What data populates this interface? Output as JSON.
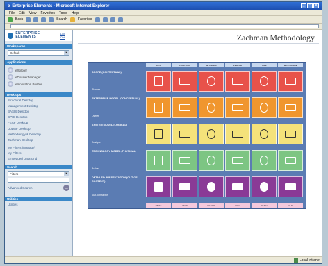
{
  "window": {
    "title": "Enterprise Elements - Microsoft Internet Explorer"
  },
  "menu": [
    "File",
    "Edit",
    "View",
    "Favorites",
    "Tools",
    "Help"
  ],
  "toolbar": {
    "back": "Back",
    "search": "Search",
    "favorites": "Favorites"
  },
  "sidebar": {
    "logo": "ENTERPRISE ELEMENTS",
    "logout": "Log Out",
    "workspaces": {
      "header": "Workspaces",
      "value": "Default"
    },
    "applications": {
      "header": "Applications",
      "items": [
        "eXplorer",
        "eDossier Manager",
        "eInnovation Builder"
      ]
    },
    "desktops": {
      "header": "Desktops",
      "items": [
        "Structural Desktop",
        "Management Desktop",
        "BASIS Desktop",
        "CPIC Desktop",
        "FEAF Desktop",
        "DoDAF Desktop",
        "Methodology & Desktop",
        "Zachman Desktop",
        "My Filters (Manage)",
        "My Filters",
        "Embedded Data Grid"
      ]
    },
    "search": {
      "header": "Search",
      "value": "Filters",
      "advanced": "Advanced Search",
      "go": "Go"
    },
    "utilities": {
      "header": "Utilities",
      "item": "Utilities"
    }
  },
  "main": {
    "title": "Zachman Methodology",
    "columns": [
      "DATA",
      "FUNCTION",
      "NETWORK",
      "PEOPLE",
      "TIME",
      "MOTIVATION"
    ],
    "footer": [
      "WHAT",
      "HOW",
      "WHERE",
      "WHO",
      "WHEN",
      "WHY"
    ],
    "rows": [
      {
        "label": "SCOPE (CONTEXTUAL)",
        "sub": "Planner",
        "color": "#e8524a"
      },
      {
        "label": "ENTERPRISE MODEL (CONCEPTUAL)",
        "sub": "Owner",
        "color": "#f0962e"
      },
      {
        "label": "SYSTEM MODEL (LOGICAL)",
        "sub": "Designer",
        "color": "#f4e27a"
      },
      {
        "label": "TECHNOLOGY MODEL (PHYSICAL)",
        "sub": "Builder",
        "color": "#7dc583"
      },
      {
        "label": "DETAILED PRESENTATION (OUT OF CONTEXT)",
        "sub": "Sub-contractor",
        "color": "#8a3a96"
      }
    ]
  },
  "status": {
    "zone": "Local intranet"
  }
}
